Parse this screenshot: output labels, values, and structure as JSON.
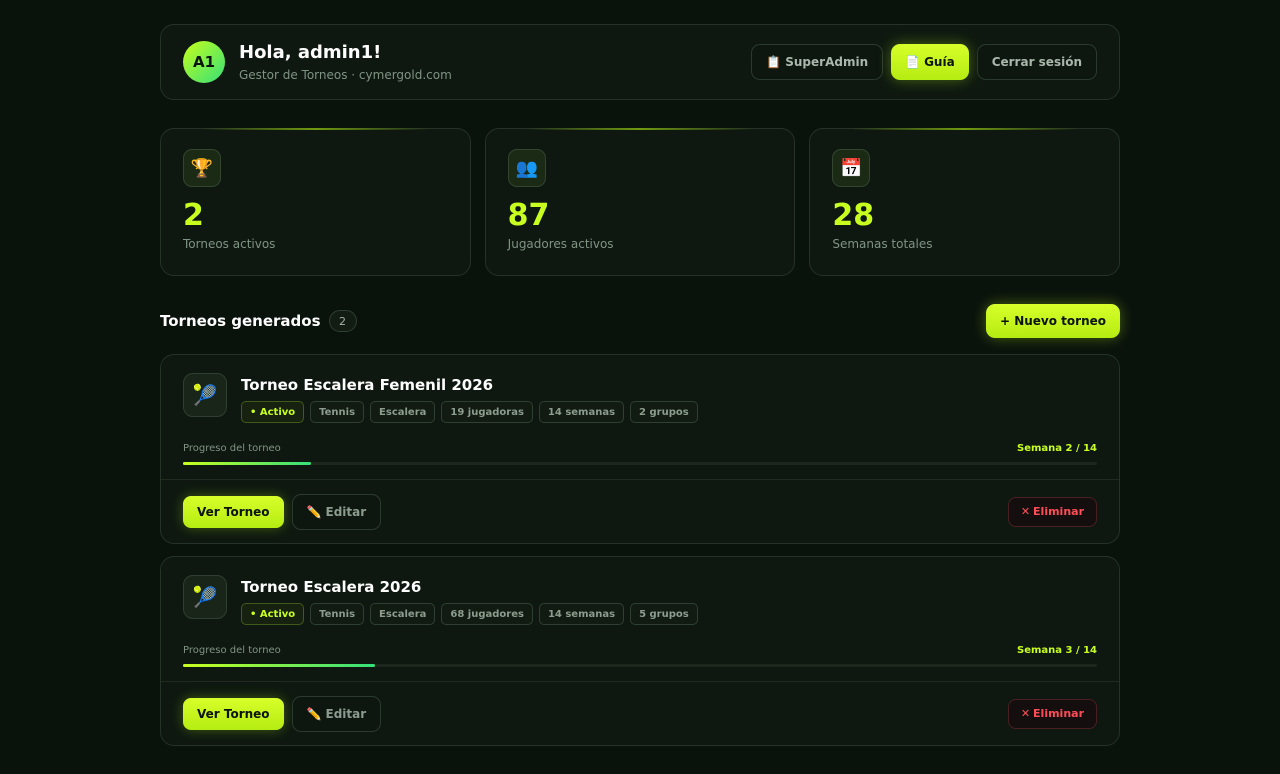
{
  "header": {
    "avatar_initials": "A1",
    "greeting": "Hola, admin1!",
    "subtitle": "Gestor de Torneos · cymergold.com",
    "buttons": {
      "superadmin": {
        "icon": "📋",
        "label": "SuperAdmin"
      },
      "guide": {
        "icon": "📄",
        "label": "Guía"
      },
      "logout": {
        "label": "Cerrar sesión"
      }
    }
  },
  "stats": [
    {
      "icon": "🏆",
      "value": "2",
      "label": "Torneos activos"
    },
    {
      "icon": "👥",
      "value": "87",
      "label": "Jugadores activos"
    },
    {
      "icon": "📅",
      "value": "28",
      "label": "Semanas totales"
    }
  ],
  "section": {
    "title": "Torneos generados",
    "count": "2",
    "new_button": "+ Nuevo torneo"
  },
  "tournaments": [
    {
      "icon": "🎾",
      "name": "Torneo Escalera Femenil 2026",
      "tags": [
        "• Activo",
        "Tennis",
        "Escalera",
        "19 jugadoras",
        "14 semanas",
        "2 grupos"
      ],
      "progress_label": "Progreso del torneo",
      "week_text": "Semana 2 / 14",
      "progress": 0.14,
      "view_label": "Ver Torneo",
      "edit_icon": "✏️",
      "edit_label": "Editar",
      "delete_icon": "✕",
      "delete_label": "Eliminar"
    },
    {
      "icon": "🎾",
      "name": "Torneo Escalera 2026",
      "tags": [
        "• Activo",
        "Tennis",
        "Escalera",
        "68 jugadores",
        "14 semanas",
        "5 grupos"
      ],
      "progress_label": "Progreso del torneo",
      "week_text": "Semana 3 / 14",
      "progress": 0.21,
      "view_label": "Ver Torneo",
      "edit_icon": "✏️",
      "edit_label": "Editar",
      "delete_icon": "✕",
      "delete_label": "Eliminar"
    }
  ]
}
